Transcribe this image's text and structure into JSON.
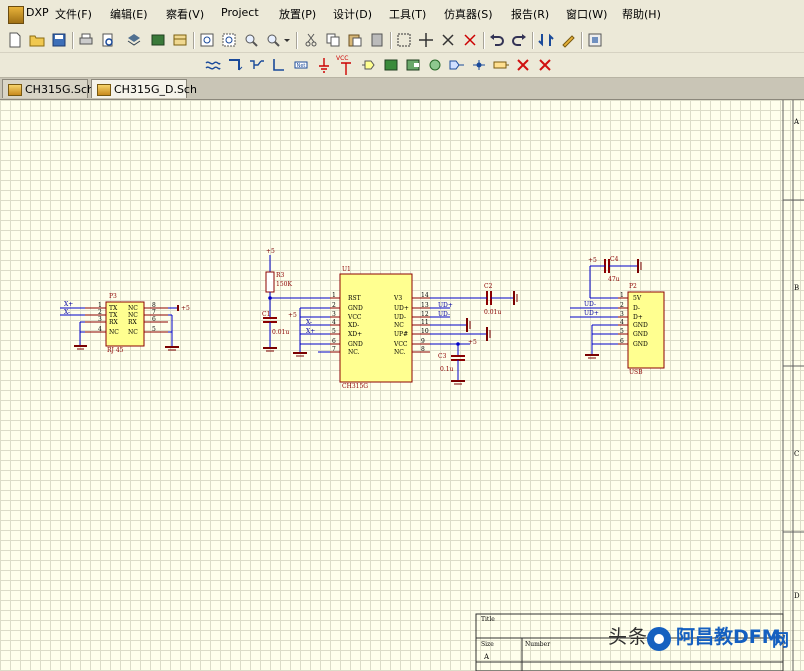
{
  "menu": {
    "logo": "DXP",
    "items": [
      "文件(F)",
      "编辑(E)",
      "察看(V)",
      "Project",
      "放置(P)",
      "设计(D)",
      "工具(T)",
      "仿真器(S)",
      "报告(R)",
      "窗口(W)",
      "帮助(H)"
    ]
  },
  "tabs": [
    {
      "label": "CH315G.Sch",
      "active": false
    },
    {
      "label": "CH315G_D.Sch",
      "active": true
    }
  ],
  "toolbar2": {
    "vcc_label": "VCC"
  },
  "border": {
    "zones": [
      "A",
      "B",
      "C",
      "D"
    ]
  },
  "schematic": {
    "p3": {
      "designator": "P3",
      "name": "RJ 45",
      "pins_left": [
        "1",
        "2",
        "3",
        "4"
      ],
      "pins_right": [
        "8",
        "7",
        "6",
        "5"
      ],
      "names_left": [
        "TX",
        "TX",
        "RX",
        "NC"
      ],
      "names_right": [
        "NC",
        "NC",
        "RX",
        "NC"
      ],
      "nets_left": [
        "X+",
        "X-"
      ],
      "net_right": "+5"
    },
    "r3": {
      "designator": "R3",
      "value": "150K",
      "net": "+5"
    },
    "c1": {
      "designator": "C1",
      "value": "0.01u"
    },
    "u1": {
      "designator": "U1",
      "part": "CH315G",
      "pins_left": [
        "1",
        "2",
        "3",
        "4",
        "5",
        "6",
        "7"
      ],
      "pins_right": [
        "14",
        "13",
        "12",
        "11",
        "10",
        "9",
        "8"
      ],
      "names_left": [
        "RST",
        "GND",
        "VCC",
        "XD-",
        "XD+",
        "GND",
        "NC."
      ],
      "names_right": [
        "V3",
        "UD+",
        "UD-",
        "NC",
        "UP#",
        "VCC",
        "NC."
      ],
      "nets_left": [
        "+5",
        "X-",
        "X+"
      ],
      "nets_right": [
        "UD+",
        "UD-"
      ],
      "net_vcc": "+5"
    },
    "c2": {
      "designator": "C2",
      "value": "0.01u"
    },
    "c3": {
      "designator": "C3",
      "value": "0.1u"
    },
    "c4": {
      "designator": "C4",
      "value": "47u",
      "net": "+5"
    },
    "p2": {
      "designator": "P2",
      "name": "USB",
      "pins": [
        "1",
        "2",
        "3",
        "4",
        "5",
        "6"
      ],
      "names": [
        "5V",
        "D-",
        "D+",
        "GND",
        "GND",
        "GND"
      ],
      "nets": [
        "UD-",
        "UD+"
      ]
    }
  },
  "title_block": {
    "title_label": "Title",
    "size_label": "Size",
    "size_value": "A",
    "number_label": "Number"
  },
  "watermark": {
    "text1": "头条",
    "text2": "阿昌教DFM",
    "text3": "网"
  },
  "colors": {
    "wire": "#0000c8",
    "component": "#8b0000",
    "body": "#ffff90",
    "power": "#7a0000",
    "text": "#0000a0"
  }
}
